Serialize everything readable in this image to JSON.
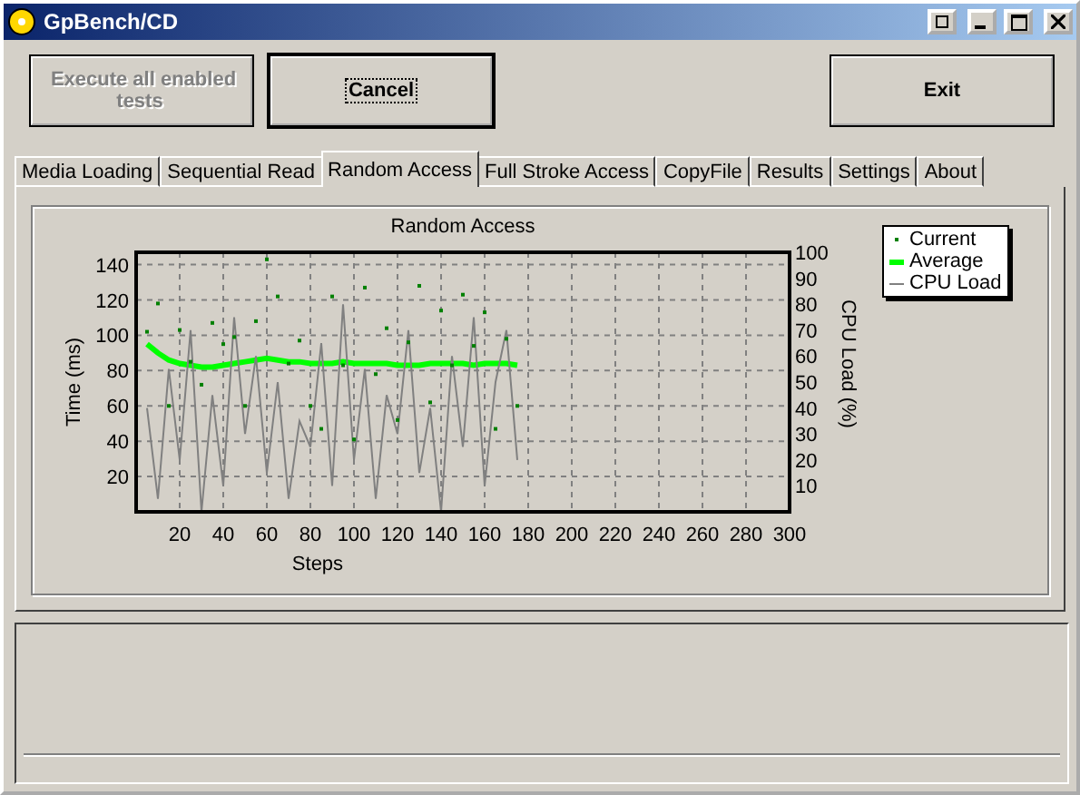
{
  "window": {
    "title": "GpBench/CD"
  },
  "buttons": [
    {
      "label": "Execute all enabled tests",
      "disabled": true,
      "focused": false
    },
    {
      "label": "Cancel",
      "disabled": false,
      "focused": true
    },
    {
      "label": "Exit",
      "disabled": false,
      "focused": false
    }
  ],
  "tabs": [
    {
      "label": "Media Loading",
      "selected": false
    },
    {
      "label": "Sequential Read",
      "selected": false
    },
    {
      "label": "Random Access",
      "selected": true
    },
    {
      "label": "Full Stroke Access",
      "selected": false
    },
    {
      "label": "CopyFile",
      "selected": false
    },
    {
      "label": "Results",
      "selected": false
    },
    {
      "label": "Settings",
      "selected": false
    },
    {
      "label": "About",
      "selected": false
    }
  ],
  "chart_data": {
    "type": "line",
    "title": "Random Access",
    "xlabel": "Steps",
    "ylabel": "Time (ms)",
    "y2label": "CPU Load (%)",
    "x": [
      5,
      10,
      15,
      20,
      25,
      30,
      35,
      40,
      45,
      50,
      55,
      60,
      65,
      70,
      75,
      80,
      85,
      90,
      95,
      100,
      105,
      110,
      115,
      120,
      125,
      130,
      135,
      140,
      145,
      150,
      155,
      160,
      165,
      170,
      175
    ],
    "series": [
      {
        "name": "Current",
        "color": "#008000",
        "type": "scatter",
        "values": [
          102,
          118,
          60,
          103,
          85,
          72,
          107,
          95,
          99,
          60,
          108,
          143,
          122,
          84,
          97,
          60,
          47,
          122,
          83,
          41,
          127,
          78,
          104,
          52,
          96,
          128,
          62,
          114,
          83,
          123,
          94,
          113,
          47,
          98,
          60
        ]
      },
      {
        "name": "Average",
        "color": "#00ff00",
        "type": "line",
        "values": [
          95,
          90,
          86,
          84,
          83,
          82,
          82,
          83,
          84,
          85,
          86,
          87,
          86,
          85,
          85,
          84,
          84,
          84,
          85,
          84,
          84,
          84,
          84,
          83,
          83,
          83,
          84,
          84,
          84,
          84,
          83,
          84,
          84,
          84,
          83
        ]
      },
      {
        "name": "CPU Load",
        "color": "#808080",
        "type": "line",
        "axis": "y2",
        "values": [
          40,
          5,
          55,
          20,
          70,
          0,
          45,
          10,
          75,
          30,
          60,
          15,
          50,
          5,
          35,
          25,
          65,
          10,
          80,
          20,
          55,
          5,
          45,
          30,
          70,
          15,
          40,
          0,
          60,
          25,
          75,
          10,
          50,
          70,
          20
        ]
      }
    ],
    "grid": true,
    "xlim": [
      0,
      300
    ],
    "ylim": [
      0,
      147
    ],
    "y2lim": [
      0,
      100
    ],
    "xticks": [
      20,
      40,
      60,
      80,
      100,
      120,
      140,
      160,
      180,
      200,
      220,
      240,
      260,
      280,
      300
    ],
    "yticks": [
      20,
      40,
      60,
      80,
      100,
      120,
      140
    ],
    "y2ticks": [
      10,
      20,
      30,
      40,
      50,
      60,
      70,
      80,
      90,
      100
    ]
  }
}
